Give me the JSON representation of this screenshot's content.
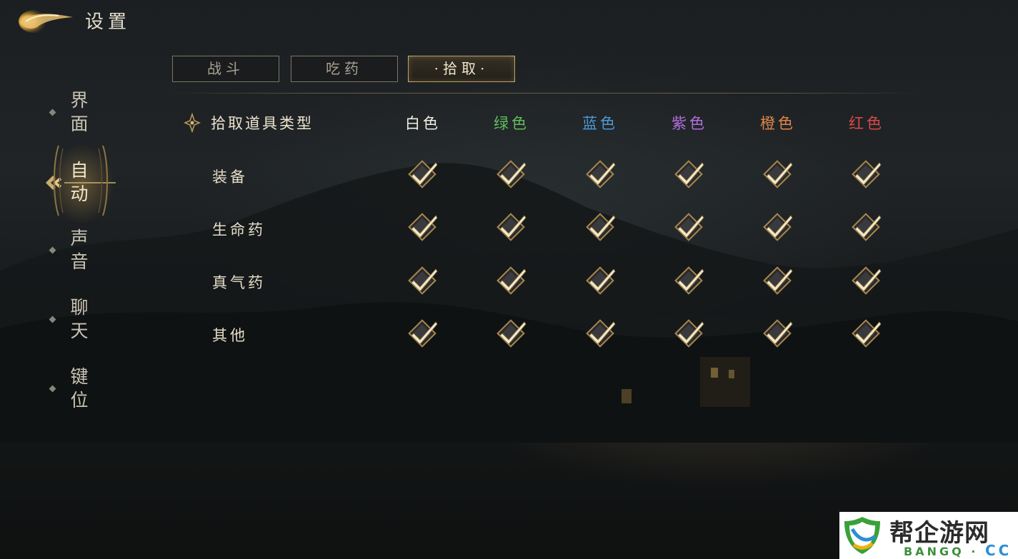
{
  "header": {
    "title": "设置"
  },
  "tabs": [
    {
      "label": "战斗",
      "active": false
    },
    {
      "label": "吃药",
      "active": false
    },
    {
      "label": "·拾取·",
      "active": true
    }
  ],
  "sidebar": {
    "items": [
      {
        "label": "界面",
        "active": false
      },
      {
        "label": "自动",
        "active": true
      },
      {
        "label": "声音",
        "active": false
      },
      {
        "label": "聊天",
        "active": false
      },
      {
        "label": "键位",
        "active": false
      }
    ]
  },
  "pickup": {
    "header_label": "拾取道具类型",
    "columns": [
      {
        "label": "白色",
        "color": "#f2eee4"
      },
      {
        "label": "绿色",
        "color": "#5fbf5a"
      },
      {
        "label": "蓝色",
        "color": "#4a9ad8"
      },
      {
        "label": "紫色",
        "color": "#b36ee0"
      },
      {
        "label": "橙色",
        "color": "#e0864a"
      },
      {
        "label": "红色",
        "color": "#d9484a"
      }
    ],
    "rows": [
      {
        "label": "装备",
        "checked": [
          true,
          true,
          true,
          true,
          true,
          true
        ]
      },
      {
        "label": "生命药",
        "checked": [
          true,
          true,
          true,
          true,
          true,
          true
        ]
      },
      {
        "label": "真气药",
        "checked": [
          true,
          true,
          true,
          true,
          true,
          true
        ]
      },
      {
        "label": "其他",
        "checked": [
          true,
          true,
          true,
          true,
          true,
          true
        ]
      }
    ]
  },
  "watermark": {
    "cn": "帮企游网",
    "en": "BANGQ",
    "dot": "·",
    "cc": "CC"
  },
  "colors": {
    "accent_gold": "#c9ad6e",
    "checkbox_fill": "#f3e9c6"
  }
}
